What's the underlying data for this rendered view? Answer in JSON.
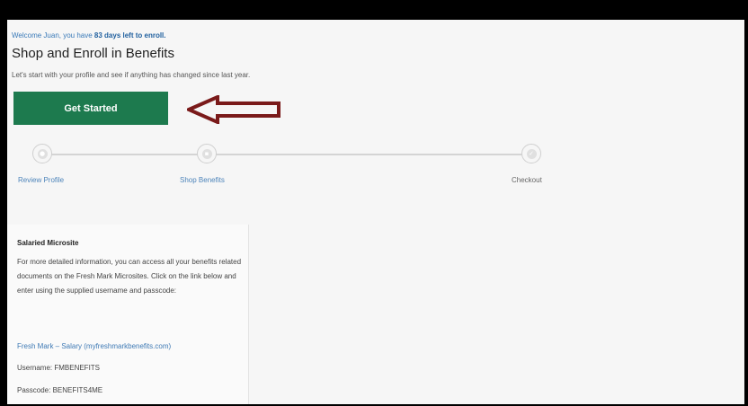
{
  "header": {
    "welcome_prefix": "Welcome Juan, you have",
    "welcome_days": "83 days left to enroll.",
    "title": "Shop and Enroll in Benefits",
    "subtitle": "Let's start with your profile and see if anything has changed since last year."
  },
  "actions": {
    "get_started_label": "Get Started"
  },
  "steps": [
    {
      "label": "Review Profile",
      "icon": "user-icon"
    },
    {
      "label": "Shop Benefits",
      "icon": "cart-icon"
    },
    {
      "label": "Checkout",
      "icon": "check-icon"
    }
  ],
  "microsite": {
    "title": "Salaried Microsite",
    "body": "For more detailed information, you can access all your benefits related documents on the Fresh Mark Microsites. Click on the link below and enter using the supplied username and passcode:",
    "link_label": "Fresh Mark – Salary (myfreshmarkbenefits.com)",
    "username": "Username: FMBENEFITS",
    "passcode": "Passcode: BENEFITS4ME"
  },
  "colors": {
    "primary_button": "#1d7a4e",
    "link": "#3f7ab5",
    "annotation_arrow": "#7a1a1a"
  }
}
